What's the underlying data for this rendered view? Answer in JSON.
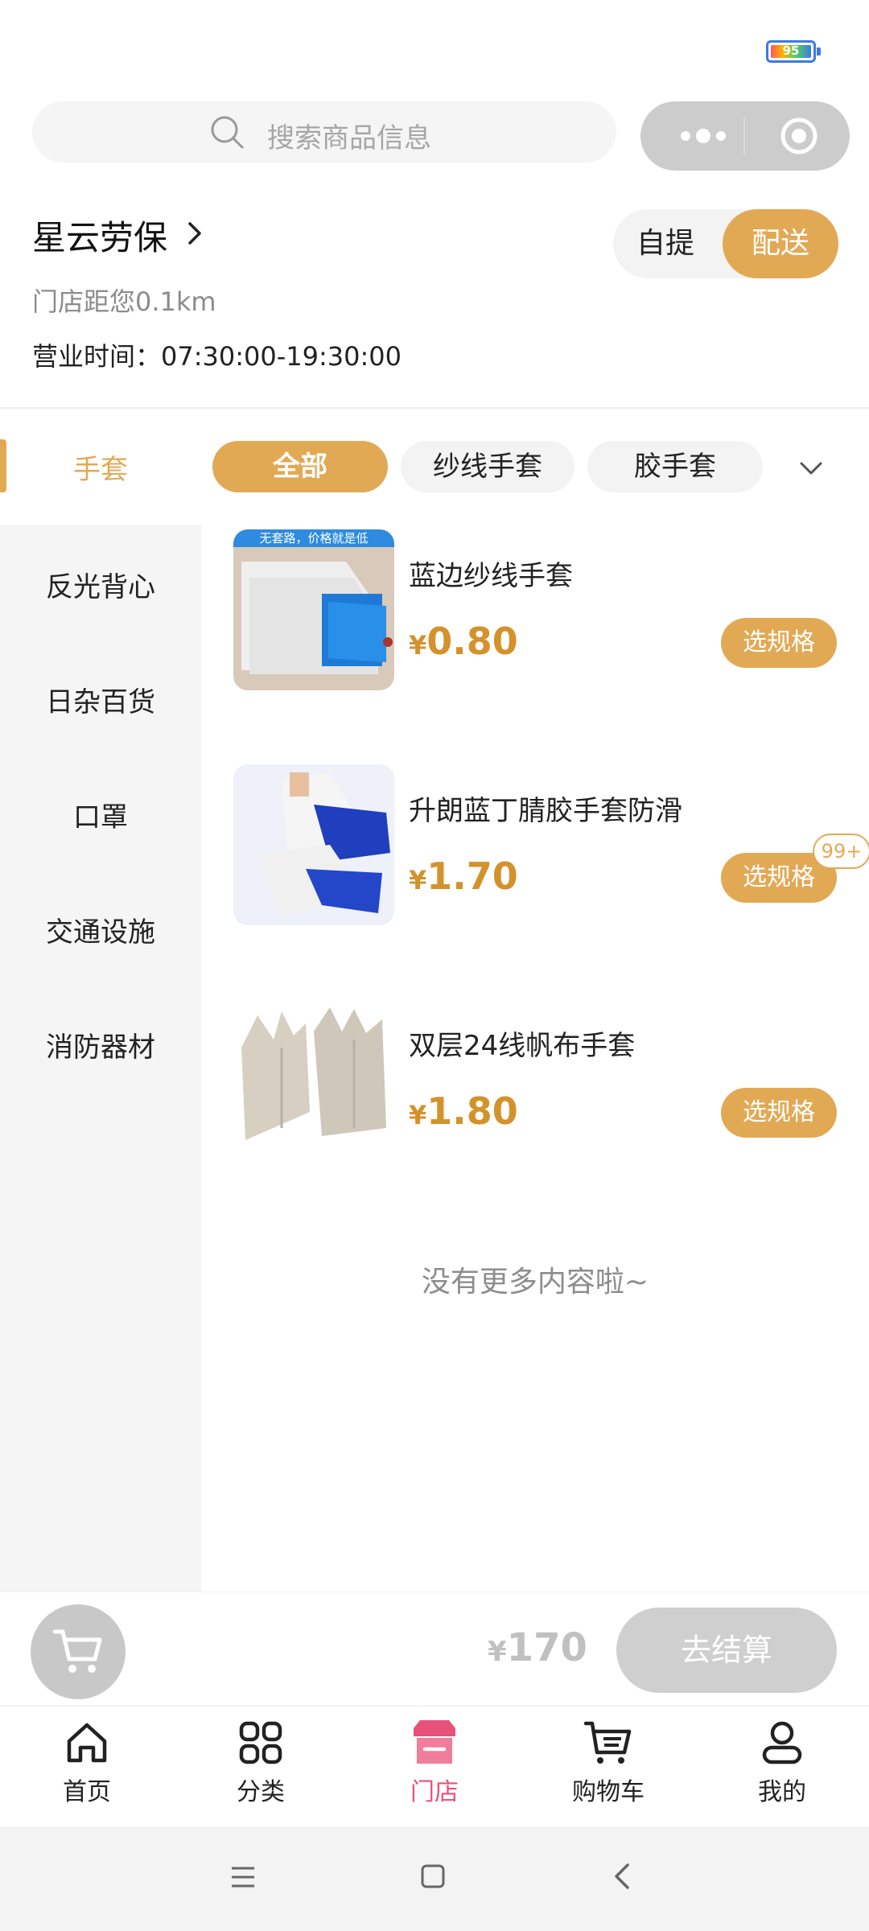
{
  "status": {
    "battery": "95"
  },
  "search": {
    "placeholder": "搜索商品信息"
  },
  "store": {
    "name": "星云劳保",
    "distance": "门店距您0.1km",
    "hours": "营业时间：07:30:00-19:30:00",
    "mode_pickup": "自提",
    "mode_delivery": "配送"
  },
  "category": {
    "current": "手套",
    "chips": [
      "全部",
      "纱线手套",
      "胶手套"
    ]
  },
  "sidebar": {
    "items": [
      "反光背心",
      "日杂百货",
      "口罩",
      "交通设施",
      "消防器材"
    ]
  },
  "products": [
    {
      "name": "蓝边纱线手套",
      "price": "0.80",
      "button": "选规格",
      "image_banner": "无套路，价格就是低"
    },
    {
      "name": "升朗蓝丁腈胶手套防滑",
      "price": "1.70",
      "button": "选规格",
      "badge": "99+"
    },
    {
      "name": "双层24线帆布手套",
      "price": "1.80",
      "button": "选规格"
    }
  ],
  "currency": "¥",
  "no_more": "没有更多内容啦~",
  "cart": {
    "total": "170",
    "checkout": "去结算"
  },
  "tabs": [
    "首页",
    "分类",
    "门店",
    "购物车",
    "我的"
  ],
  "colors": {
    "accent": "#e2a955",
    "price": "#d4922c",
    "active_tab": "#e8517a"
  }
}
